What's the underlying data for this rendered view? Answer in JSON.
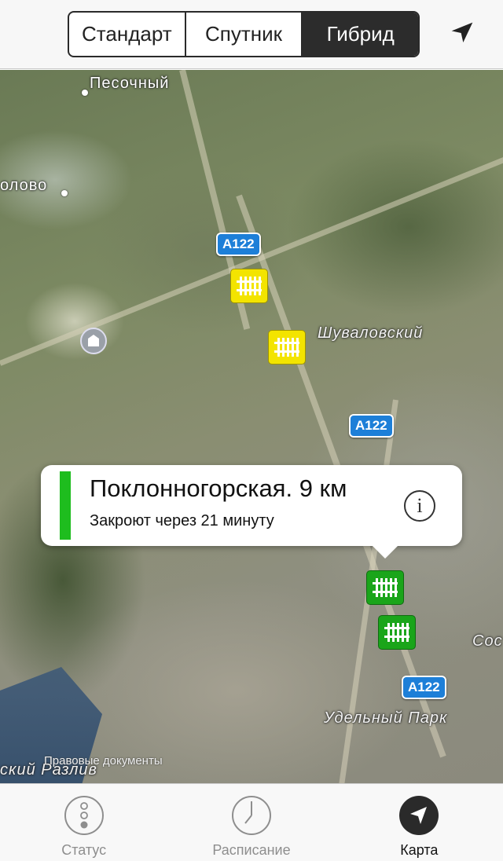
{
  "segmented": {
    "options": [
      "Стандарт",
      "Спутник",
      "Гибрид"
    ],
    "selected": "Гибрид"
  },
  "toolbar": {
    "location_icon": "location-arrow-icon"
  },
  "map": {
    "labels": {
      "pesochny": "Песочный",
      "olovo": "олово",
      "shuvalovsky": "Шуваловский",
      "udelny": "Удельный Парк",
      "razliv": "ский Разлив",
      "sos": "Сос"
    },
    "road_shields": {
      "a1": "A122",
      "a2": "A122",
      "a3": "A122"
    },
    "legal": "Правовые документы"
  },
  "callout": {
    "title": "Поклонногорская. 9 км",
    "subtitle": "Закроют через 21 минуту",
    "status_color": "#1ebd1e",
    "info_glyph": "i"
  },
  "tabs": [
    {
      "label": "Статус",
      "icon": "traffic-light-icon"
    },
    {
      "label": "Расписание",
      "icon": "clock-icon"
    },
    {
      "label": "Карта",
      "icon": "location-arrow-icon",
      "active": true
    }
  ],
  "colors": {
    "crossing_open": "#f3e400",
    "crossing_closed": "#1aa51a",
    "road_shield": "#1d7fd8"
  }
}
